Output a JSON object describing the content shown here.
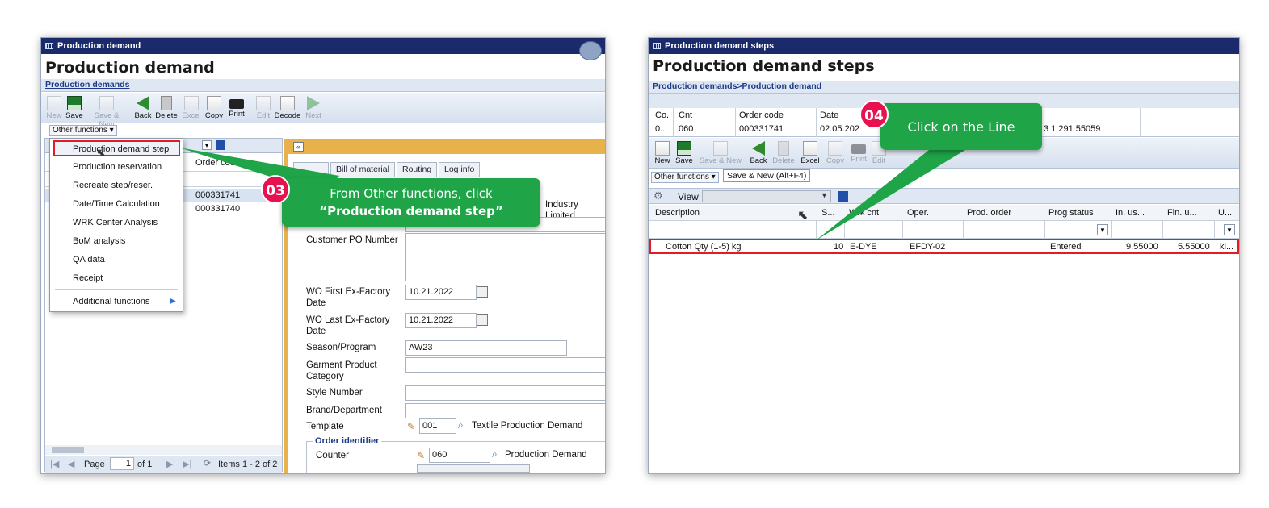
{
  "left": {
    "window_title": "Production demand",
    "page_title": "Production demand",
    "breadcrumb": "Production demands",
    "toolbar": [
      "New",
      "Save",
      "Save & New",
      "Back",
      "Delete",
      "Excel",
      "Copy",
      "Print",
      "Edit",
      "Decode",
      "Next"
    ],
    "other_functions": "Other functions",
    "menu_items": [
      "Production demand step",
      "Production reservation",
      "Recreate step/reser.",
      "Date/Time Calculation",
      "WRK Center Analysis",
      "BoM analysis",
      "QA data",
      "Receipt",
      "Additional functions"
    ],
    "list_header": "Order code",
    "list_rows": [
      "000331741",
      "000331740"
    ],
    "pager": {
      "page_label": "Page",
      "page": "1",
      "of": "of 1",
      "items": "Items 1 - 2 of 2"
    },
    "tabs": [
      "Bill of material",
      "Routing",
      "Log info"
    ],
    "partial_text": "Industry Limited",
    "form": {
      "customer_po": "Customer PO Number",
      "wo_first": "WO First Ex-Factory Date",
      "wo_first_val": "10.21.2022",
      "wo_last": "WO Last Ex-Factory Date",
      "wo_last_val": "10.21.2022",
      "season": "Season/Program",
      "season_val": "AW23",
      "garment": "Garment Product Category",
      "style": "Style Number",
      "brand": "Brand/Department",
      "template": "Template",
      "template_val": "001",
      "template_desc": "Textile Production Demand",
      "order_identifier": "Order identifier",
      "counter": "Counter",
      "counter_val": "060",
      "counter_desc": "Production Demand"
    },
    "callout": {
      "badge": "03",
      "line1": "From Other functions, click",
      "line2": "“Production demand step”"
    }
  },
  "right": {
    "window_title": "Production demand steps",
    "page_title": "Production demand steps",
    "breadcrumb": "Production demands>Production demand",
    "header_cols": [
      "Co.",
      "Cnt",
      "Order code",
      "Date"
    ],
    "header_vals": [
      "0..",
      "060",
      "000331741",
      "02.05.202"
    ],
    "header_partial": "3 1 291 55059",
    "toolbar": [
      "New",
      "Save",
      "Save & New",
      "Back",
      "Delete",
      "Excel",
      "Copy",
      "Print",
      "Edit"
    ],
    "other_functions": "Other functions",
    "tooltip": "Save & New (Alt+F4)",
    "view_label": "View",
    "columns": [
      "Description",
      "S...",
      "Wrk cnt",
      "Oper.",
      "Prod. order",
      "Prog status",
      "In. us...",
      "Fin. u...",
      "U..."
    ],
    "row": [
      "Cotton Qty (1-5) kg",
      "10",
      "E-DYE",
      "EFDY-02",
      "",
      "Entered",
      "9.55000",
      "5.55000",
      "ki..."
    ],
    "callout": {
      "badge": "04",
      "text": "Click on the Line"
    }
  },
  "colors": {
    "callout": "#1fa448",
    "badge": "#e8104f",
    "titlebar": "#1b2a6b",
    "highlight": "#e31b23"
  }
}
